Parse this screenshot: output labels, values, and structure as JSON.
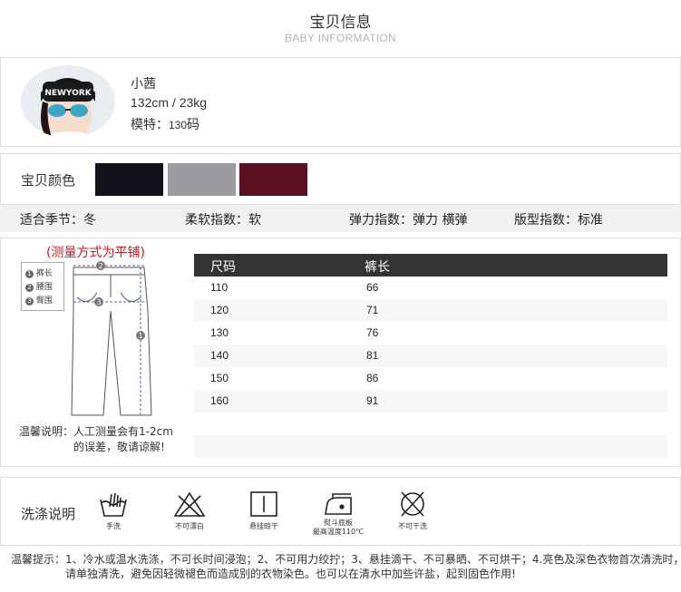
{
  "header": {
    "title": "宝贝信息",
    "subtitle": "BABY INFORMATION"
  },
  "model": {
    "name": "小茜",
    "stats": "132cm / 23kg",
    "size_label": "模特：",
    "size_value": "130",
    "size_suffix": "码"
  },
  "colors": {
    "label": "宝贝颜色",
    "swatches": [
      "#12131a",
      "#9c9ca0",
      "#5b1022"
    ]
  },
  "attributes": [
    {
      "label": "适合季节：",
      "value": "冬"
    },
    {
      "label": "柔软指数：",
      "value": "软"
    },
    {
      "label": "弹力指数：",
      "value": "弹力 横弹"
    },
    {
      "label": "版型指数：",
      "value": "标准"
    }
  ],
  "measure": {
    "title": "(测量方式为平铺)",
    "legend": [
      {
        "num": "1",
        "text": "裤长"
      },
      {
        "num": "2",
        "text": "腰围"
      },
      {
        "num": "3",
        "text": "臀围"
      }
    ],
    "markers": [
      "2",
      "3",
      "1"
    ],
    "note_line1": "温馨说明：人工测量会有1-2cm",
    "note_line2": "的误差，敬请谅解!"
  },
  "size_table": {
    "headers": [
      "尺码",
      "裤长"
    ],
    "rows": [
      [
        "110",
        "66"
      ],
      [
        "120",
        "71"
      ],
      [
        "130",
        "76"
      ],
      [
        "140",
        "81"
      ],
      [
        "150",
        "86"
      ],
      [
        "160",
        "91"
      ]
    ]
  },
  "care": {
    "label": "洗涤说明",
    "icons": [
      {
        "icon": "hand-wash-icon",
        "text": "手洗"
      },
      {
        "icon": "no-bleach-icon",
        "text": "不可漂白"
      },
      {
        "icon": "hang-dry-icon",
        "text": "悬挂晾干"
      },
      {
        "icon": "iron-icon",
        "text": "熨斗底板",
        "text2": "最高温度110℃"
      },
      {
        "icon": "no-tumble-dry-icon",
        "text": "不可干洗"
      }
    ]
  },
  "notice": {
    "line1": "温馨提示：1、冷水或温水洗涤，不可长时间浸泡；2、不可用力绞拧；3、悬挂滴干、不可暴晒、不可烘干；4.亮色及深色衣物首次清洗时，",
    "line2": "请单独清洗，避免因轻微褪色而造成别的衣物染色。也可以在清水中加些许盐，起到固色作用!"
  }
}
